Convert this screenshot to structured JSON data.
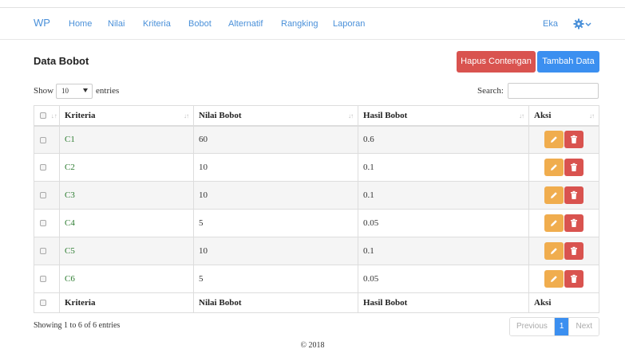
{
  "navbar": {
    "brand": "WP",
    "items": [
      "Home",
      "Nilai",
      "Kriteria",
      "Bobot",
      "Alternatif",
      "Rangking",
      "Laporan"
    ],
    "user": "Eka",
    "settings_icon": "gear-icon"
  },
  "panel": {
    "title": "Data Bobot",
    "hapus_label": "Hapus Contengan",
    "tambah_label": "Tambah Data"
  },
  "table_controls": {
    "show_label": "Show",
    "page_size": "10",
    "entries_label": "entries",
    "search_label": "Search:",
    "search_value": ""
  },
  "table": {
    "headers": [
      "Kriteria",
      "Nilai Bobot",
      "Hasil Bobot",
      "Aksi"
    ],
    "rows": [
      {
        "kriteria": "C1",
        "nilai": "60",
        "hasil": "0.6"
      },
      {
        "kriteria": "C2",
        "nilai": "10",
        "hasil": "0.1"
      },
      {
        "kriteria": "C3",
        "nilai": "10",
        "hasil": "0.1"
      },
      {
        "kriteria": "C4",
        "nilai": "5",
        "hasil": "0.05"
      },
      {
        "kriteria": "C5",
        "nilai": "10",
        "hasil": "0.1"
      },
      {
        "kriteria": "C6",
        "nilai": "5",
        "hasil": "0.05"
      }
    ],
    "footers": [
      "Kriteria",
      "Nilai Bobot",
      "Hasil Bobot",
      "Aksi"
    ]
  },
  "pagination": {
    "info": "Showing 1 to 6 of 6 entries",
    "previous": "Previous",
    "current": "1",
    "next": "Next"
  },
  "footer": {
    "copyright": "© 2018"
  },
  "colors": {
    "link": "#4a90d9",
    "danger": "#d9534f",
    "primary": "#3b8ff0",
    "warning": "#f0ad4e",
    "kriteria_text": "#2e7d32"
  }
}
